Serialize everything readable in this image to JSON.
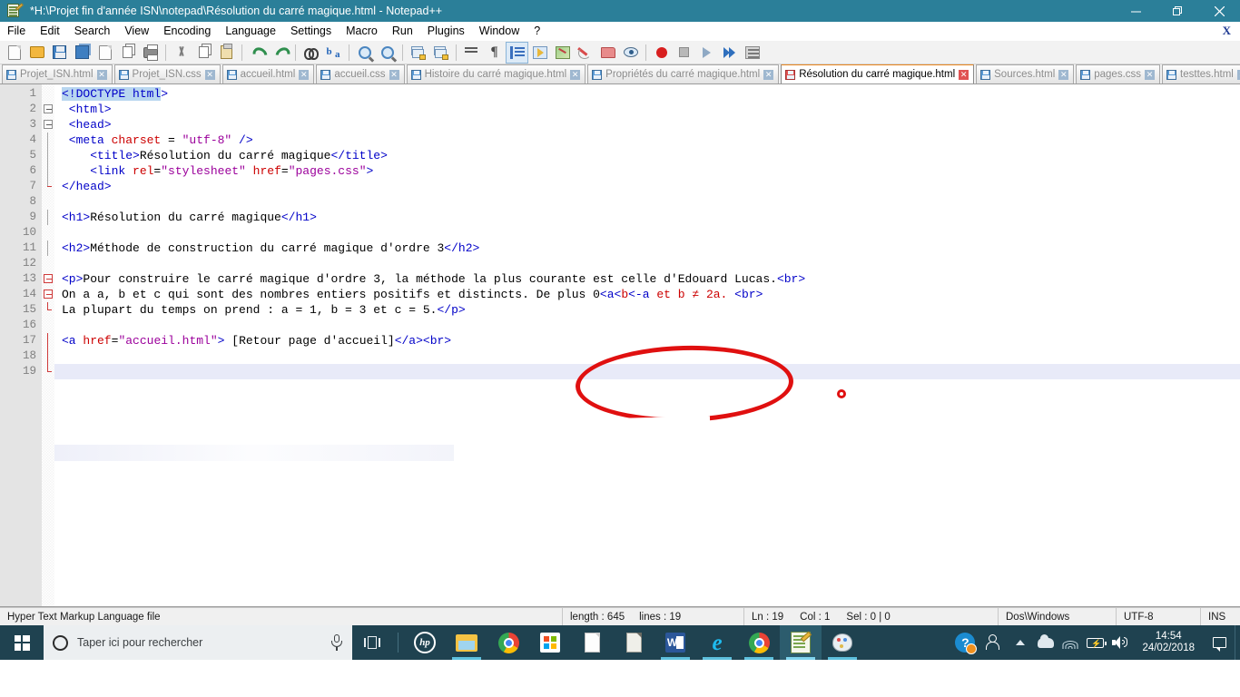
{
  "window": {
    "title": "*H:\\Projet fin d'année ISN\\notepad\\Résolution du carré magique.html - Notepad++",
    "app_icon": "notepadpp-icon",
    "minimize_label": "—",
    "restore_label": "❐",
    "close_label": "✕"
  },
  "menu": {
    "items": [
      {
        "label": "File",
        "name": "menu-file"
      },
      {
        "label": "Edit",
        "name": "menu-edit"
      },
      {
        "label": "Search",
        "name": "menu-search"
      },
      {
        "label": "View",
        "name": "menu-view"
      },
      {
        "label": "Encoding",
        "name": "menu-encoding"
      },
      {
        "label": "Language",
        "name": "menu-language"
      },
      {
        "label": "Settings",
        "name": "menu-settings"
      },
      {
        "label": "Macro",
        "name": "menu-macro"
      },
      {
        "label": "Run",
        "name": "menu-run"
      },
      {
        "label": "Plugins",
        "name": "menu-plugins"
      },
      {
        "label": "Window",
        "name": "menu-window"
      },
      {
        "label": "?",
        "name": "menu-help"
      }
    ],
    "close_document_label": "X"
  },
  "toolbar": {
    "icons": [
      "new-file-icon",
      "open-file-icon",
      "save-icon",
      "save-all-icon",
      "close-file-icon",
      "close-all-files-icon",
      "print-icon",
      "sep",
      "cut-icon",
      "copy-icon",
      "paste-icon",
      "sep",
      "undo-icon",
      "redo-icon",
      "sep",
      "find-icon",
      "replace-icon",
      "sep",
      "zoom-in-icon",
      "zoom-out-icon",
      "sep",
      "sync-vertical-scroll-icon",
      "sync-horizontal-scroll-icon",
      "sep",
      "word-wrap-icon",
      "show-all-characters-icon",
      "indent-guide-icon",
      "ui-user-defined-dialog-icon",
      "document-map-icon",
      "function-list-icon",
      "folder-as-workspace-icon",
      "monitoring-icon",
      "sep",
      "macro-record-icon",
      "macro-stop-icon",
      "macro-play-icon",
      "macro-run-multiple-icon",
      "macro-save-icon"
    ]
  },
  "tabs": {
    "items": [
      {
        "label": "Projet_ISN.html",
        "active": false,
        "modified": false
      },
      {
        "label": "Projet_ISN.css",
        "active": false,
        "modified": false
      },
      {
        "label": "accueil.html",
        "active": false,
        "modified": false
      },
      {
        "label": "accueil.css",
        "active": false,
        "modified": false
      },
      {
        "label": "Histoire du carré magique.html",
        "active": false,
        "modified": false
      },
      {
        "label": "Propriétés du carré magique.html",
        "active": false,
        "modified": false
      },
      {
        "label": "Résolution du carré magique.html",
        "active": true,
        "modified": true
      },
      {
        "label": "Sources.html",
        "active": false,
        "modified": false
      },
      {
        "label": "pages.css",
        "active": false,
        "modified": false
      },
      {
        "label": "testtes.html",
        "active": false,
        "modified": false
      }
    ],
    "close_glyph": "✕"
  },
  "editor": {
    "current_line": 19,
    "lines": [
      {
        "n": "1",
        "fold": "none",
        "segments": [
          {
            "t": "<!DOCTYPE html",
            "c": "tg",
            "sel": true
          },
          {
            "t": ">",
            "c": "tg"
          }
        ]
      },
      {
        "n": "2",
        "fold": "open",
        "segments": [
          {
            "t": " <html>",
            "c": "tg"
          }
        ]
      },
      {
        "n": "3",
        "fold": "open",
        "segments": [
          {
            "t": " <head>",
            "c": "tg"
          }
        ]
      },
      {
        "n": "4",
        "fold": "line",
        "segments": [
          {
            "t": " <meta ",
            "c": "tg"
          },
          {
            "t": "charset",
            "c": "at"
          },
          {
            "t": " = ",
            "c": "tx"
          },
          {
            "t": "\"utf-8\"",
            "c": "st"
          },
          {
            "t": " />",
            "c": "tg"
          }
        ]
      },
      {
        "n": "5",
        "fold": "line",
        "segments": [
          {
            "t": "    <title>",
            "c": "tg"
          },
          {
            "t": "Résolution du carré magique",
            "c": "tx"
          },
          {
            "t": "</title>",
            "c": "tg"
          }
        ]
      },
      {
        "n": "6",
        "fold": "line",
        "segments": [
          {
            "t": "    <link ",
            "c": "tg"
          },
          {
            "t": "rel",
            "c": "at"
          },
          {
            "t": "=",
            "c": "tx"
          },
          {
            "t": "\"stylesheet\"",
            "c": "st"
          },
          {
            "t": " ",
            "c": "tx"
          },
          {
            "t": "href",
            "c": "at"
          },
          {
            "t": "=",
            "c": "tx"
          },
          {
            "t": "\"pages.css\"",
            "c": "st"
          },
          {
            "t": ">",
            "c": "tg"
          }
        ]
      },
      {
        "n": "7",
        "fold": "end",
        "segments": [
          {
            "t": "</head>",
            "c": "tg"
          }
        ]
      },
      {
        "n": "8",
        "fold": "none",
        "segments": []
      },
      {
        "n": "9",
        "fold": "line",
        "segments": [
          {
            "t": "<h1>",
            "c": "tg"
          },
          {
            "t": "Résolution du carré magique",
            "c": "tx"
          },
          {
            "t": "</h1>",
            "c": "tg"
          }
        ]
      },
      {
        "n": "10",
        "fold": "none",
        "segments": []
      },
      {
        "n": "11",
        "fold": "line",
        "segments": [
          {
            "t": "<h2>",
            "c": "tg"
          },
          {
            "t": "Méthode de construction du carré magique d'ordre 3",
            "c": "tx"
          },
          {
            "t": "</h2>",
            "c": "tg"
          }
        ]
      },
      {
        "n": "12",
        "fold": "none",
        "segments": []
      },
      {
        "n": "13",
        "fold": "open-red",
        "segments": [
          {
            "t": "<p>",
            "c": "tg"
          },
          {
            "t": "Pour construire le carré magique d'ordre 3, la méthode la plus courante est celle d'Edouard Lucas.",
            "c": "tx"
          },
          {
            "t": "<br>",
            "c": "tg"
          }
        ]
      },
      {
        "n": "14",
        "fold": "open-red",
        "segments": [
          {
            "t": "On a a, b et c qui sont des nombres entiers positifs et distincts. De plus 0",
            "c": "tx"
          },
          {
            "t": "<a<",
            "c": "tg"
          },
          {
            "t": "b",
            "c": "at"
          },
          {
            "t": "<-a",
            "c": "tg"
          },
          {
            "t": " et ",
            "c": "at"
          },
          {
            "t": "b ≠ 2a. ",
            "c": "at"
          },
          {
            "t": "<br>",
            "c": "tg"
          }
        ]
      },
      {
        "n": "15",
        "fold": "tail-red",
        "segments": [
          {
            "t": "La plupart du temps on prend : a = 1, b = 3 et c = 5.",
            "c": "tx"
          },
          {
            "t": "</p>",
            "c": "tg"
          }
        ]
      },
      {
        "n": "16",
        "fold": "none",
        "segments": []
      },
      {
        "n": "17",
        "fold": "line-red",
        "segments": [
          {
            "t": "<a ",
            "c": "tg"
          },
          {
            "t": "href",
            "c": "at"
          },
          {
            "t": "=",
            "c": "tx"
          },
          {
            "t": "\"accueil.html\"",
            "c": "st"
          },
          {
            "t": "> ",
            "c": "tg"
          },
          {
            "t": "[Retour page d'accueil]",
            "c": "tx"
          },
          {
            "t": "</a><br>",
            "c": "tg"
          }
        ]
      },
      {
        "n": "18",
        "fold": "line-red",
        "segments": []
      },
      {
        "n": "19",
        "fold": "tail-red2",
        "segments": []
      }
    ],
    "annotations": [
      {
        "type": "ellipse",
        "name": "red-ellipse-annotation",
        "color": "#e01010"
      },
      {
        "type": "dot",
        "name": "red-dot-annotation",
        "color": "#e01010"
      }
    ]
  },
  "statusbar": {
    "doc_type": "Hyper Text Markup Language file",
    "length_label": "length : 645",
    "lines_label": "lines : 19",
    "ln_label": "Ln : 19",
    "col_label": "Col : 1",
    "sel_label": "Sel : 0 | 0",
    "eol": "Dos\\Windows",
    "encoding": "UTF-8",
    "insert_mode": "INS"
  },
  "taskbar": {
    "start_name": "windows-start-button",
    "search_placeholder": "Taper ici pour rechercher",
    "apps": [
      {
        "name": "taskbar-hp-support",
        "icon": "hp-icon",
        "active": false,
        "running": false
      },
      {
        "name": "taskbar-file-explorer",
        "icon": "folder-icon",
        "active": false,
        "running": true
      },
      {
        "name": "taskbar-chrome",
        "icon": "chrome-icon",
        "active": false,
        "running": false
      },
      {
        "name": "taskbar-microsoft-store",
        "icon": "store-icon",
        "active": false,
        "running": false
      },
      {
        "name": "taskbar-notepad",
        "icon": "document-icon",
        "active": false,
        "running": false
      },
      {
        "name": "taskbar-libreoffice",
        "icon": "document-icon",
        "active": false,
        "running": false
      },
      {
        "name": "taskbar-word",
        "icon": "word-icon",
        "active": false,
        "running": true
      },
      {
        "name": "taskbar-internet-explorer",
        "icon": "ie-icon",
        "active": false,
        "running": true
      },
      {
        "name": "taskbar-chrome-profile",
        "icon": "chrome-icon",
        "active": false,
        "running": true
      },
      {
        "name": "taskbar-notepadpp",
        "icon": "notepadpp-icon",
        "active": true,
        "running": true
      },
      {
        "name": "taskbar-paint",
        "icon": "paint-icon",
        "active": false,
        "running": true
      }
    ],
    "word_letter": "W",
    "ie_letter": "e",
    "hp_letter": "hp",
    "help_letter": "?",
    "battery_letter": "⚡",
    "tray": [
      {
        "name": "tray-help-support",
        "icon": "help-icon"
      },
      {
        "name": "tray-people",
        "icon": "people-icon"
      },
      {
        "name": "tray-show-hidden-icons",
        "icon": "chevron-up-icon"
      },
      {
        "name": "tray-onedrive",
        "icon": "cloud-icon"
      },
      {
        "name": "tray-network",
        "icon": "wifi-icon"
      },
      {
        "name": "tray-battery",
        "icon": "battery-charging-icon"
      },
      {
        "name": "tray-volume",
        "icon": "speaker-icon"
      }
    ],
    "time": "14:54",
    "date": "24/02/2018"
  }
}
